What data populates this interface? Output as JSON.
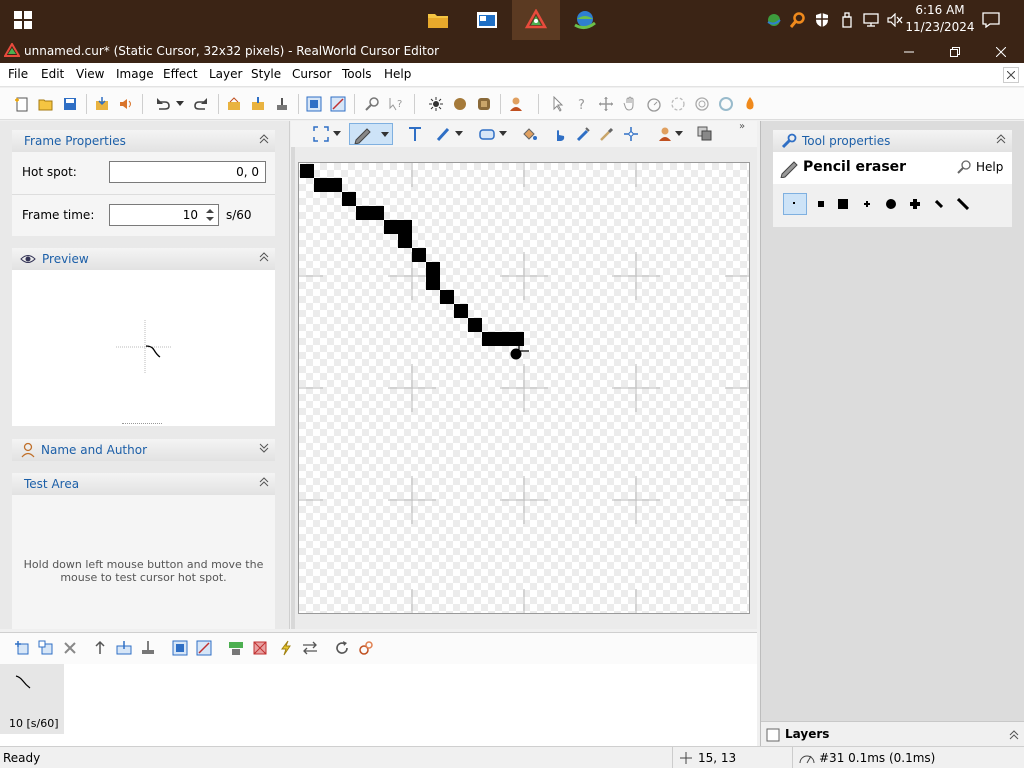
{
  "taskbar": {
    "apps": [
      {
        "name": "File Explorer"
      },
      {
        "name": "Window app"
      },
      {
        "name": "RealWorld Cursor Editor"
      },
      {
        "name": "Internet Download Manager"
      }
    ],
    "clock": {
      "time": "6:16 AM",
      "date": "11/23/2024"
    }
  },
  "window": {
    "title": "unnamed.cur* (Static Cursor, 32x32 pixels) - RealWorld Cursor Editor"
  },
  "menu": [
    "File",
    "Edit",
    "View",
    "Image",
    "Effect",
    "Layer",
    "Style",
    "Cursor",
    "Tools",
    "Help"
  ],
  "frame_properties": {
    "title": "Frame Properties",
    "hotspot_label": "Hot spot:",
    "hotspot_value": "0, 0",
    "frametime_label": "Frame time:",
    "frametime_value": "10",
    "frametime_unit": "s/60"
  },
  "preview": {
    "title": "Preview"
  },
  "name_author": {
    "title": "Name and Author"
  },
  "test_area": {
    "title": "Test Area",
    "text": "Hold down left mouse button and move the mouse to test cursor hot spot."
  },
  "tool_properties": {
    "title": "Tool properties",
    "tool_name": "Pencil eraser",
    "help_label": "Help"
  },
  "frames": {
    "items": [
      {
        "label": "10 [s/60]"
      }
    ]
  },
  "layers": {
    "title": "Layers"
  },
  "status": {
    "text": "Ready",
    "coords": "15, 13",
    "layer_info": "#31 0.1ms (0.1ms)"
  },
  "colors": {
    "taskbar": "#3b2415",
    "accent": "#1c5fa8"
  }
}
